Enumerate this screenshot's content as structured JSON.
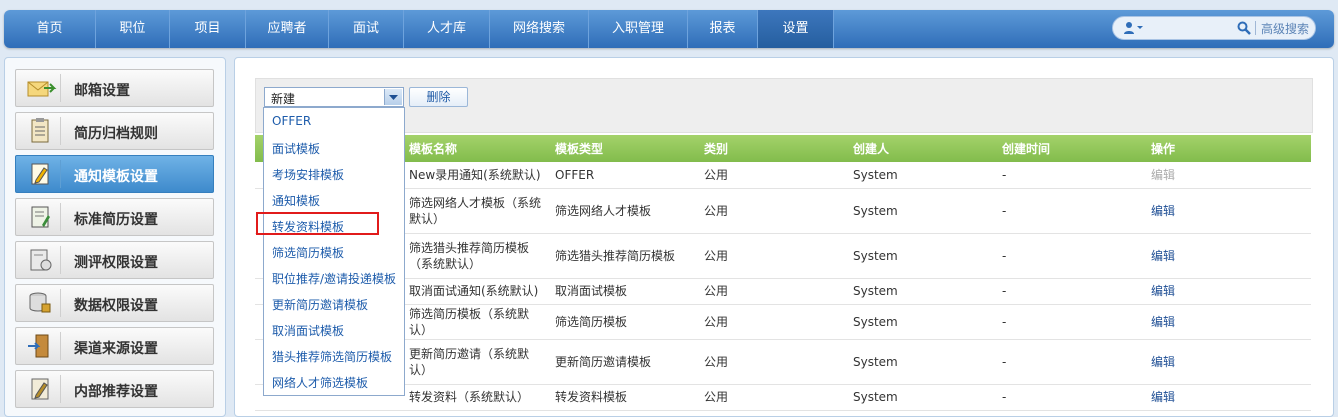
{
  "nav": {
    "items": [
      "首页",
      "职位",
      "项目",
      "应聘者",
      "面试",
      "人才库",
      "网络搜索",
      "入职管理",
      "报表",
      "设置"
    ],
    "active": "设置",
    "search_value": "",
    "advanced_search_label": "高级搜索"
  },
  "sidebar": {
    "items": [
      {
        "label": "邮箱设置",
        "icon": "mail-settings-icon"
      },
      {
        "label": "简历归档规则",
        "icon": "clipboard-icon"
      },
      {
        "label": "通知模板设置",
        "icon": "edit-note-icon",
        "active": true
      },
      {
        "label": "标准简历设置",
        "icon": "resume-edit-icon"
      },
      {
        "label": "测评权限设置",
        "icon": "assessment-icon"
      },
      {
        "label": "数据权限设置",
        "icon": "database-icon"
      },
      {
        "label": "渠道来源设置",
        "icon": "door-icon"
      },
      {
        "label": "内部推荐设置",
        "icon": "recommend-icon"
      }
    ]
  },
  "toolbar": {
    "select_value": "新建",
    "delete_label": "删除"
  },
  "dropdown": {
    "options": [
      "OFFER",
      "面试模板",
      "考场安排模板",
      "通知模板",
      "转发资料模板",
      "筛选简历模板",
      "职位推荐/邀请投递模板",
      "更新简历邀请模板",
      "取消面试模板",
      "猎头推荐筛选简历模板",
      "网络人才筛选模板"
    ],
    "highlighted": "转发资料模板"
  },
  "table": {
    "headers": [
      "模板名称",
      "模板类型",
      "类别",
      "创建人",
      "创建时间",
      "操作"
    ],
    "rows": [
      {
        "name": "New录用通知(系统默认)",
        "type": "OFFER",
        "category": "公用",
        "creator": "System",
        "created": "-",
        "action": "编辑",
        "disabled": true
      },
      {
        "name": "筛选网络人才模板（系统默认）",
        "type": "筛选网络人才模板",
        "category": "公用",
        "creator": "System",
        "created": "-",
        "action": "编辑"
      },
      {
        "name": "筛选猎头推荐简历模板（系统默认）",
        "type": "筛选猎头推荐简历模板",
        "category": "公用",
        "creator": "System",
        "created": "-",
        "action": "编辑"
      },
      {
        "name": "取消面试通知(系统默认)",
        "type": "取消面试模板",
        "category": "公用",
        "creator": "System",
        "created": "-",
        "action": "编辑"
      },
      {
        "name": "筛选简历模板（系统默认）",
        "type": "筛选简历模板",
        "category": "公用",
        "creator": "System",
        "created": "-",
        "action": "编辑"
      },
      {
        "name": "更新简历邀请（系统默认）",
        "type": "更新简历邀请模板",
        "category": "公用",
        "creator": "System",
        "created": "-",
        "action": "编辑"
      },
      {
        "name": "转发资料（系统默认）",
        "type": "转发资料模板",
        "category": "公用",
        "creator": "System",
        "created": "-",
        "action": "编辑"
      }
    ]
  }
}
